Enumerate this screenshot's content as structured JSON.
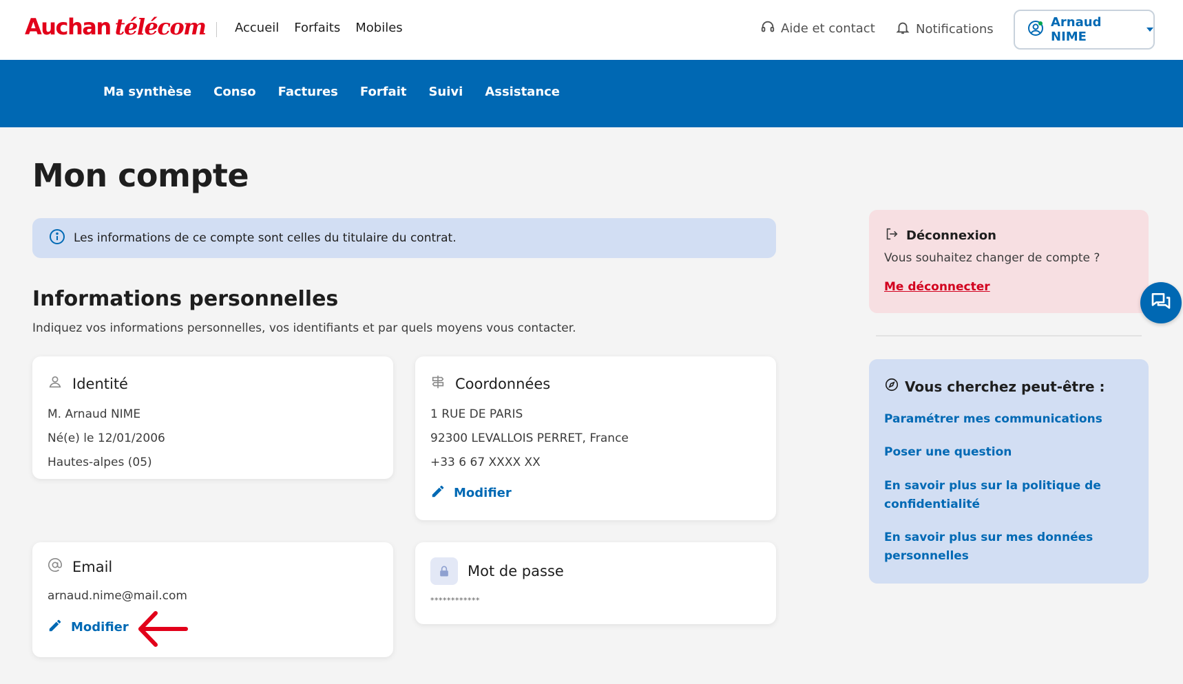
{
  "header": {
    "logo_brand": "Auchan",
    "logo_sub": "télécom",
    "nav": [
      "Accueil",
      "Forfaits",
      "Mobiles"
    ],
    "help_label": "Aide et contact",
    "notifications_label": "Notifications",
    "account_label": "Arnaud NIME"
  },
  "subnav": [
    "Ma synthèse",
    "Conso",
    "Factures",
    "Forfait",
    "Suivi",
    "Assistance"
  ],
  "main": {
    "title": "Mon compte",
    "info_banner": "Les informations de ce compte sont celles du titulaire du contrat.",
    "section_title": "Informations personnelles",
    "section_sub": "Indiquez vos informations personnelles, vos identifiants et par quels moyens vous contacter.",
    "identite": {
      "title": "Identité",
      "lines": [
        "M. Arnaud NIME",
        "Né(e) le 12/01/2006",
        "Hautes-alpes (05)"
      ]
    },
    "coordonnees": {
      "title": "Coordonnées",
      "lines": [
        "1 RUE DE PARIS",
        "92300 LEVALLOIS PERRET, France",
        "+33 6 67 XXXX XX"
      ],
      "modify_label": "Modifier"
    },
    "email": {
      "title": "Email",
      "value": "arnaud.nime@mail.com",
      "modify_label": "Modifier"
    },
    "mot_de_passe": {
      "title": "Mot de passe",
      "value": "************"
    }
  },
  "sidebar": {
    "logout": {
      "title": "Déconnexion",
      "question": "Vous souhaitez changer de compte ?",
      "link": "Me déconnecter"
    },
    "suggestions": {
      "title": "Vous cherchez peut-être :",
      "links": [
        "Paramétrer mes communications",
        "Poser une question",
        "En savoir plus sur la politique de confidentialité",
        "En savoir plus sur mes données personnelles"
      ]
    }
  },
  "colors": {
    "brand_red": "#e2001a",
    "brand_blue": "#0068b3",
    "link_blue": "#0069b4",
    "info_bg": "#d2def3",
    "logout_bg": "#f7dfe2",
    "annotation_arrow": "#e2001a"
  }
}
